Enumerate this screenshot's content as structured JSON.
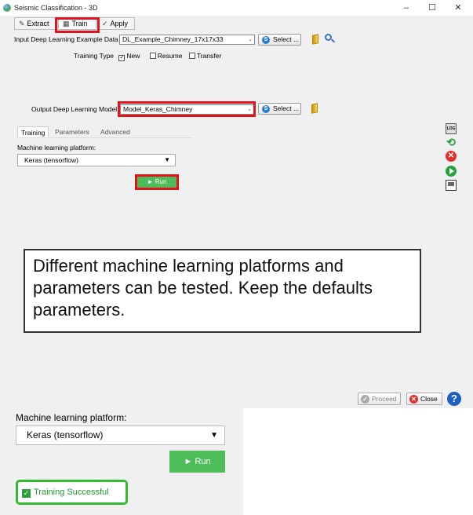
{
  "window": {
    "title": "Seismic Classification - 3D",
    "minimize": "–",
    "maximize": "☐",
    "close": "✕"
  },
  "tabs": [
    {
      "label": "Extract",
      "icon": "pencil-icon"
    },
    {
      "label": "Train",
      "icon": "train-icon"
    },
    {
      "label": "Apply",
      "icon": "apply-icon"
    }
  ],
  "input": {
    "label": "Input Deep Learning Example Data",
    "value": "DL_Example_Chimney_17x17x33",
    "select_label": "Select ..."
  },
  "training_type": {
    "label": "Training Type",
    "options": [
      {
        "label": "New",
        "checked": true
      },
      {
        "label": "Resume",
        "checked": false
      },
      {
        "label": "Transfer",
        "checked": false
      }
    ]
  },
  "output": {
    "label": "Output Deep Learning Model",
    "value": "Model_Keras_Chimney",
    "select_label": "Select ..."
  },
  "subtabs": [
    "Training",
    "Parameters",
    "Advanced"
  ],
  "platform": {
    "label": "Machine learning platform:",
    "value": "Keras (tensorflow)"
  },
  "run_label": "► Run",
  "side_icons": [
    "log-icon",
    "refresh-icon",
    "stop-icon",
    "play-icon",
    "save-icon"
  ],
  "callout": "Different machine learning platforms and parameters can be tested. Keep the defaults parameters.",
  "bottom": {
    "proceed": "Proceed",
    "close": "Close",
    "help": "?"
  },
  "zoom": {
    "platform_label": "Machine learning platform:",
    "platform_value": "Keras (tensorflow)",
    "run_label": "► Run",
    "status": "Training Successful"
  },
  "colors": {
    "highlight": "#e0141e",
    "run_green": "#4dbd5a",
    "success_border": "#35b935",
    "select_blue": "#2a7fd4"
  }
}
